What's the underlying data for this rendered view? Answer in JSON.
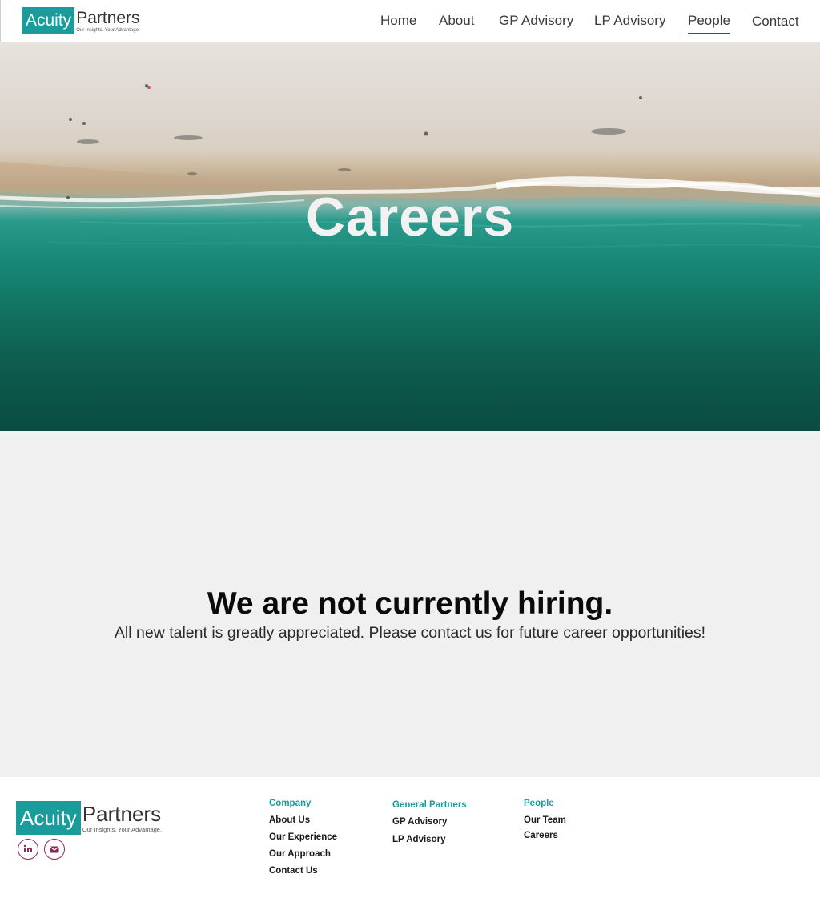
{
  "brand": {
    "logo_box_text": "Acuity",
    "logo_word": "Partners",
    "tagline": "Our Insights. Your Advantage.",
    "teal": "#1a9c9c",
    "accent": "#8a2a5a"
  },
  "nav": {
    "home": "Home",
    "about": "About",
    "gp": "GP Advisory",
    "lp": "LP Advisory",
    "people": "People",
    "contact": "Contact",
    "active": "People"
  },
  "hero": {
    "title": "Careers"
  },
  "main": {
    "headline": "We are not currently hiring.",
    "subline": "All new talent is greatly appreciated. Please contact us for future career opportunities!"
  },
  "footer": {
    "social": {
      "linkedin_icon": "linkedin-icon",
      "email_icon": "email-icon"
    },
    "company": {
      "heading": "Company",
      "links": [
        "About Us",
        "Our Experience",
        "Our Approach",
        "Contact Us"
      ]
    },
    "general_partners": {
      "heading": "General Partners",
      "links": [
        "GP Advisory",
        "LP Advisory"
      ]
    },
    "people": {
      "heading": "People",
      "links": [
        "Our Team",
        "Careers"
      ]
    }
  }
}
